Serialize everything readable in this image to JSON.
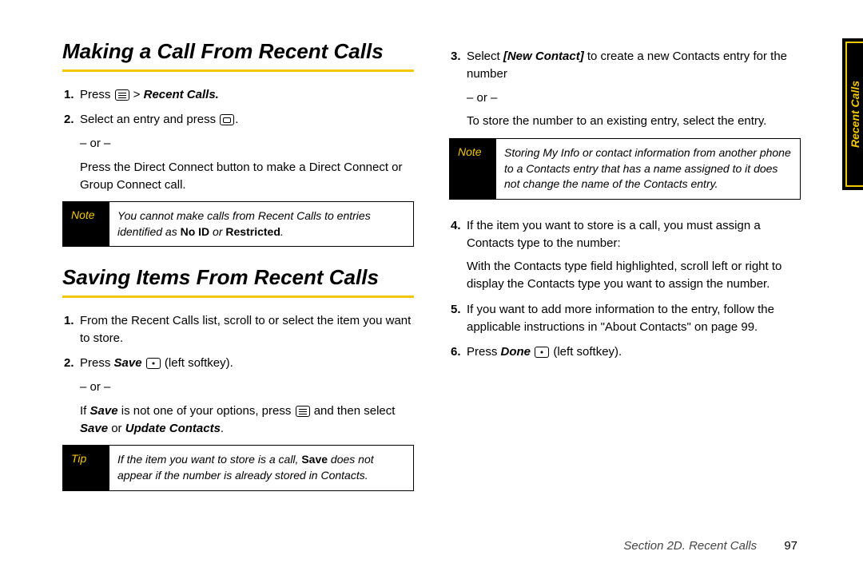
{
  "side_tab": "Recent Calls",
  "footer": {
    "section": "Section 2D. Recent Calls",
    "page": "97"
  },
  "h1": "Making a Call From Recent Calls",
  "s1": {
    "n1": "1.",
    "l1a": "Press ",
    "l1b": " > ",
    "l1c": "Recent Calls.",
    "n2": "2.",
    "l2a": "Select an entry and press ",
    "l2b": ".",
    "or": "– or –",
    "l2c": "Press the Direct Connect button to make a Direct Connect or Group Connect call."
  },
  "note1": {
    "tag": "Note",
    "a": "You cannot make calls from Recent Calls to entries identified as ",
    "b": "No ID",
    "c": " or ",
    "d": "Restricted",
    "e": "."
  },
  "h2": "Saving Items From Recent Calls",
  "s2": {
    "n1": "1.",
    "l1": "From the Recent Calls list, scroll to or select the item you want to store.",
    "n2": "2.",
    "l2a": "Press ",
    "l2b": "Save",
    "l2c": " ",
    "l2d": " (left softkey).",
    "or": "– or –",
    "l2e": "If ",
    "l2f": "Save",
    "l2g": " is not one of your options, press ",
    "l2h": " and then select ",
    "l2i": "Save",
    "l2j": " or ",
    "l2k": "Update Contacts",
    "l2l": "."
  },
  "tip": {
    "tag": "Tip",
    "a": "If the item you want to store is a call, ",
    "b": "Save",
    "c": " does not appear if the number is already stored in Contacts."
  },
  "s3": {
    "n3": "3.",
    "l3a": "Select ",
    "l3b": "[New Contact]",
    "l3c": " to create a new Contacts entry for the number",
    "or": "– or –",
    "l3d": "To store the number to an existing entry, select the entry."
  },
  "note2": {
    "tag": "Note",
    "a": "Storing My Info or contact information from another phone to a Contacts entry that has a name assigned to it does not change the name of the Contacts entry."
  },
  "s4": {
    "n4": "4.",
    "l4a": "If the item you want to store is a call, you must assign a Contacts type to the number:",
    "l4b": "With the Contacts type field highlighted, scroll left or right to display the Contacts type you want to assign the number.",
    "n5": "5.",
    "l5": "If you want to add more information to the entry, follow the applicable instructions in \"About Contacts\" on page 99.",
    "n6": "6.",
    "l6a": "Press ",
    "l6b": "Done",
    "l6c": " ",
    "l6d": " (left softkey)."
  }
}
